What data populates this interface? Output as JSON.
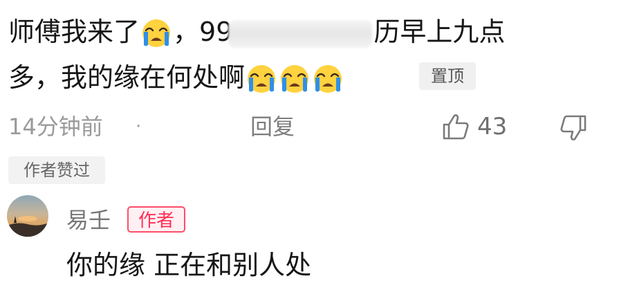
{
  "comment": {
    "line1_start": "师傅我来了",
    "line1_mid": "，99",
    "line1_end": "历早上九点",
    "line2_start": "多，我的缘在何处啊",
    "pin_badge": "置顶",
    "emoji_name": "loudly-crying-face"
  },
  "meta": {
    "time": "14分钟前",
    "dot": "·",
    "reply_label": "回复",
    "like_count": "43"
  },
  "author_liked_badge": "作者赞过",
  "reply": {
    "author_name": "易壬",
    "author_tag": "作者",
    "text": "你的缘 正在和别人处"
  },
  "colors": {
    "author_tag": "#ff2f55",
    "meta_text": "#9a9a9a",
    "emoji_face": "#ffcc33",
    "emoji_tears": "#2f8fe8"
  }
}
